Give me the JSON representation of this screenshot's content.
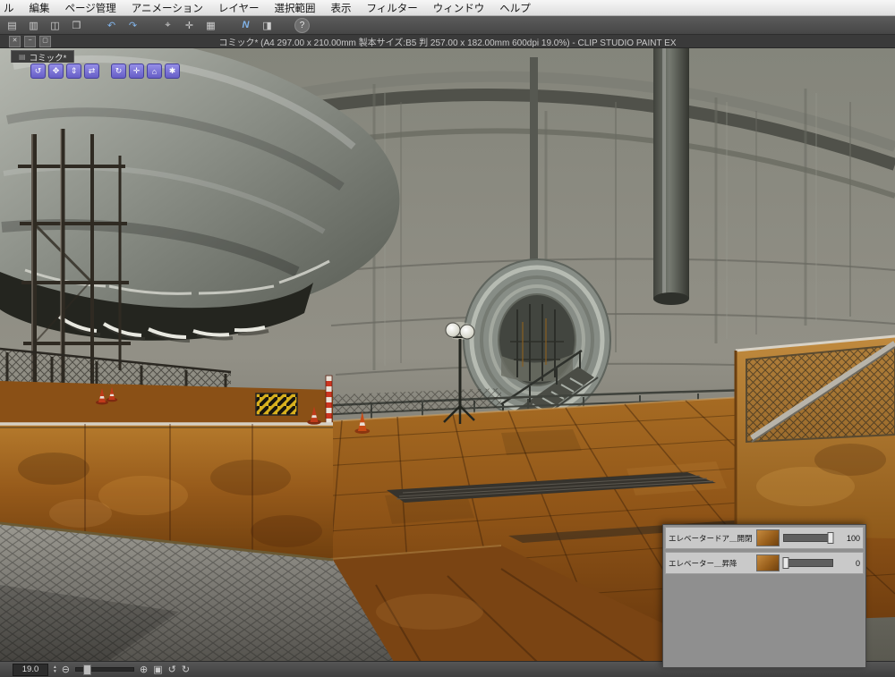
{
  "window": {
    "title": "コミック* (A4 297.00 x 210.00mm 製本サイズ:B5 判 257.00 x 182.00mm 600dpi 19.0%)  - CLIP STUDIO PAINT EX",
    "buttons": [
      {
        "name": "close",
        "glyph": "✕"
      },
      {
        "name": "minimize",
        "glyph": "−"
      },
      {
        "name": "maximize",
        "glyph": "▢"
      }
    ]
  },
  "menu_bar": {
    "items": [
      "ル",
      "編集",
      "ページ管理",
      "アニメーション",
      "レイヤー",
      "選択範囲",
      "表示",
      "フィルター",
      "ウィンドウ",
      "ヘルプ"
    ]
  },
  "toolbar": {
    "icons": [
      {
        "name": "new-page-icon",
        "glyph": "▤"
      },
      {
        "name": "open-page-icon",
        "glyph": "▥"
      },
      {
        "name": "save-icon",
        "glyph": "◫"
      },
      {
        "name": "export-icon",
        "glyph": "❒"
      },
      {
        "name": "undo-icon",
        "glyph": "↶"
      },
      {
        "name": "redo-icon",
        "glyph": "↷"
      },
      {
        "name": "snap-icon",
        "glyph": "⌖"
      },
      {
        "name": "move-icon",
        "glyph": "✛"
      },
      {
        "name": "grid-icon",
        "glyph": "▦"
      },
      {
        "name": "vector-icon",
        "glyph": "N"
      },
      {
        "name": "ruler-icon",
        "glyph": "◨"
      },
      {
        "name": "help-icon",
        "glyph": "?"
      }
    ]
  },
  "canvas": {
    "tab_label": "コミック*",
    "tab_glyph": "▤",
    "camera_tools": [
      {
        "name": "camera-rotate-icon",
        "glyph": "↺"
      },
      {
        "name": "camera-pan-icon",
        "glyph": "✥"
      },
      {
        "name": "camera-zoom-icon",
        "glyph": "⇕"
      },
      {
        "name": "camera-dolly-icon",
        "glyph": "⇄"
      },
      {
        "name": "object-rotate-icon",
        "glyph": "↻"
      },
      {
        "name": "object-pan-icon",
        "glyph": "✛"
      },
      {
        "name": "object-home-icon",
        "glyph": "⌂"
      },
      {
        "name": "object-settings-icon",
        "glyph": "✱"
      }
    ]
  },
  "object_panel": {
    "rows": [
      {
        "label": "エレベータードア＿開閉",
        "value": "100",
        "percent": 100
      },
      {
        "label": "エレベーター＿昇降",
        "value": "0",
        "percent": 0
      }
    ]
  },
  "status_bar": {
    "zoom_value": "19.0",
    "step_up_glyph": "▴",
    "step_down_glyph": "▾",
    "zoom_out_glyph": "⊖",
    "zoom_in_glyph": "⊕",
    "fit_glyph": "▣",
    "rotate_left_glyph": "↺",
    "rotate_right_glyph": "↻"
  },
  "colors": {
    "accent_blue": "#5b9bd5",
    "rust_orange": "#96591a",
    "concrete_gray": "#8b8c83",
    "panel_gray": "#8f8f8f",
    "camera_tool_purple": "#7a72d6"
  }
}
